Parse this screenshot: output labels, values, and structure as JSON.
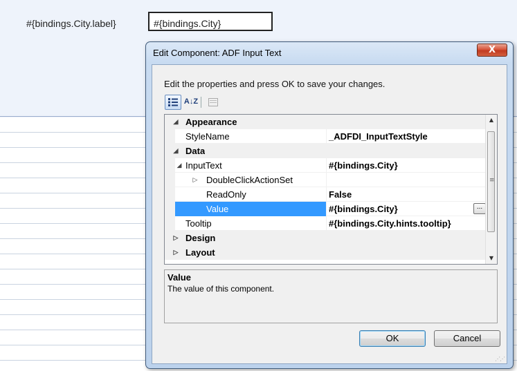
{
  "background": {
    "label": "#{bindings.City.label}",
    "input_value": "#{bindings.City}"
  },
  "dialog": {
    "title": "Edit Component: ADF Input Text",
    "close_glyph": "X",
    "instructions": "Edit the properties and press OK to save your changes.",
    "toolbar": {
      "categorized_icon": "categorized-view-icon",
      "alphabetical_label": "A↓Z",
      "pages_icon": "property-pages-icon"
    },
    "grid": {
      "rows": [
        {
          "kind": "category",
          "name": "Appearance",
          "expanded": true
        },
        {
          "kind": "property",
          "name": "StyleName",
          "value": "_ADFDI_InputTextStyle",
          "indent": 1
        },
        {
          "kind": "category",
          "name": "Data",
          "expanded": true
        },
        {
          "kind": "property",
          "name": "InputText",
          "value": "#{bindings.City}",
          "indent": 1,
          "expander": "expanded"
        },
        {
          "kind": "property",
          "name": "DoubleClickActionSet",
          "value": "",
          "indent": 2,
          "expander": "collapsed"
        },
        {
          "kind": "property",
          "name": "ReadOnly",
          "value": "False",
          "indent": 3
        },
        {
          "kind": "property",
          "name": "Value",
          "value": "#{bindings.City}",
          "indent": 3,
          "selected": true,
          "ellipsis": "..."
        },
        {
          "kind": "property",
          "name": "Tooltip",
          "value": "#{bindings.City.hints.tooltip}",
          "indent": 1
        },
        {
          "kind": "category",
          "name": "Design",
          "expanded": false
        },
        {
          "kind": "category",
          "name": "Layout",
          "expanded": false
        }
      ]
    },
    "description": {
      "title": "Value",
      "text": "The value of this component."
    },
    "buttons": {
      "ok": "OK",
      "cancel": "Cancel"
    }
  },
  "colors": {
    "selection": "#3399ff",
    "dialog_border": "#3f5a7a",
    "close_button": "#c03a1f"
  }
}
